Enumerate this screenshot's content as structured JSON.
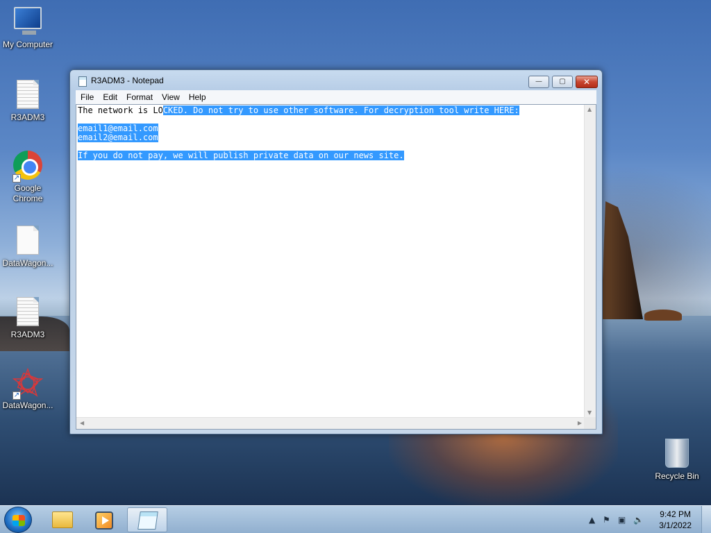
{
  "desktop": {
    "icons": [
      {
        "label": "My Computer",
        "icon": "computer-icon"
      },
      {
        "label": "R3ADM3",
        "icon": "text-file-icon"
      },
      {
        "label": "Google Chrome",
        "icon": "chrome-icon"
      },
      {
        "label": "DataWagon...",
        "icon": "blank-file-icon"
      },
      {
        "label": "R3ADM3",
        "icon": "text-file-icon"
      },
      {
        "label": "DataWagon...",
        "icon": "star-app-icon"
      },
      {
        "label": "Recycle Bin",
        "icon": "recycle-bin-icon"
      }
    ]
  },
  "window": {
    "title": "R3ADM3 - Notepad",
    "controls": {
      "minimize": "—",
      "maximize": "▢",
      "close": "✕"
    },
    "menu": [
      "File",
      "Edit",
      "Format",
      "View",
      "Help"
    ],
    "content": {
      "line1_plain": "The network is LO",
      "line1_selected": "CKED. Do not try to use other software. For decryption tool write HERE:",
      "email1": "email1@email.com",
      "email2": "email2@email.com",
      "line4": "If you do not pay, we will publish private data on our news site."
    }
  },
  "taskbar": {
    "buttons": [
      {
        "name": "windows-explorer",
        "icon": "folder-icon"
      },
      {
        "name": "media-player",
        "icon": "media-player-icon"
      },
      {
        "name": "notepad",
        "icon": "notepad-icon",
        "active": true
      }
    ],
    "tray": {
      "time": "9:42 PM",
      "date": "3/1/2022"
    }
  },
  "colors": {
    "selection": "#3399ff",
    "close_button": "#c8452f"
  }
}
